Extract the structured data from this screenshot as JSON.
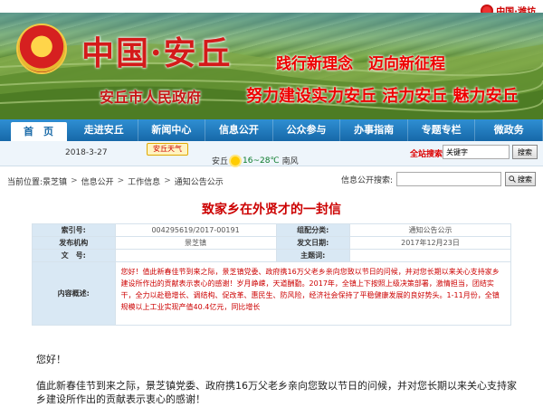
{
  "header": {
    "city_logo_text": "中国·潍坊",
    "site_title": "中国·安丘",
    "gov_name": "安丘市人民政府",
    "slogan_line1": "践行新理念　迈向新征程",
    "slogan_line2": "努力建设实力安丘  活力安丘  魅力安丘"
  },
  "nav": {
    "items": [
      "首　页",
      "走进安丘",
      "新闻中心",
      "信息公开",
      "公众参与",
      "办事指南",
      "专题专栏",
      "微政务"
    ]
  },
  "infobar": {
    "date": "2018-3-27",
    "weather_badge": "安丘天气",
    "city": "安丘",
    "temp": "16~28℃",
    "wind": "南风",
    "search_label": "全站搜索:",
    "search_value": "关键字",
    "search_button": "搜索"
  },
  "breadcrumb": {
    "prefix": "当前位置:",
    "items": [
      "景芝镇",
      "信息公开",
      "工作信息",
      "通知公告公示"
    ],
    "pub_search_label": "信息公开搜索:",
    "pub_search_button": "搜索"
  },
  "document": {
    "title": "致家乡在外贤才的一封信",
    "rows": {
      "index_label": "索引号:",
      "index_value": "004295619/2017-00191",
      "category_label": "组配分类:",
      "category_value": "通知公告公示",
      "org_label": "发布机构",
      "org_value": "景芝镇",
      "date_label": "发文日期:",
      "date_value": "2017年12月23日",
      "docno_label": "文　号:",
      "docno_value": "",
      "subject_label": "主题词:",
      "subject_value": "",
      "summary_label": "内容概述:",
      "summary_value": "您好！值此新春佳节到来之际，景芝镇党委、政府携16万父老乡亲向您致以节日的问候，并对您长期以来关心支持家乡建设所作出的贡献表示衷心的感谢！岁月峥嵘，天道酬勤。2017年，全镇上下按照上级决策部署，激情担当，团结实干，全力以赴稳增长、调结构、促改革、惠民生、防风险，经济社会保持了平稳健康发展的良好势头。1-11月份，全镇规模以上工业实现产值40.4亿元，同比增长"
    },
    "greeting": "您好！",
    "paragraph": "值此新春佳节到来之际，景芝镇党委、政府携16万父老乡亲向您致以节日的问候，并对您长期以来关心支持家乡建设所作出的贡献表示衷心的感谢！"
  }
}
